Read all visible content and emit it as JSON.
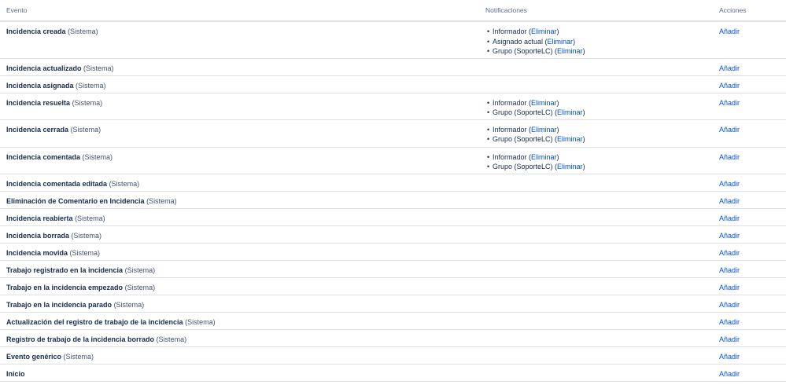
{
  "columns": {
    "event": "Evento",
    "notifications": "Notificaciones",
    "actions": "Acciones"
  },
  "colors": {
    "link": "#0052cc",
    "text": "#172b4d",
    "muted": "#5e6c84",
    "border": "#dfe1e6"
  },
  "icons": {
    "list_bullet": "•"
  },
  "remove_label": "Eliminar",
  "rows": [
    {
      "name": "Incidencia creada",
      "scope": "(Sistema)",
      "action": "Añadir",
      "notifications": [
        {
          "recipient": "Informador"
        },
        {
          "recipient": "Asignado actual"
        },
        {
          "recipient": "Grupo (SoporteLC)"
        }
      ]
    },
    {
      "name": "Incidencia actualizado",
      "scope": "(Sistema)",
      "action": "Añadir",
      "notifications": []
    },
    {
      "name": "Incidencia asignada",
      "scope": "(Sistema)",
      "action": "Añadir",
      "notifications": []
    },
    {
      "name": "Incidencia resuelta",
      "scope": "(Sistema)",
      "action": "Añadir",
      "notifications": [
        {
          "recipient": "Informador"
        },
        {
          "recipient": "Grupo (SoporteLC)"
        }
      ]
    },
    {
      "name": "Incidencia cerrada",
      "scope": "(Sistema)",
      "action": "Añadir",
      "notifications": [
        {
          "recipient": "Informador"
        },
        {
          "recipient": "Grupo (SoporteLC)"
        }
      ]
    },
    {
      "name": "Incidencia comentada",
      "scope": "(Sistema)",
      "action": "Añadir",
      "notifications": [
        {
          "recipient": "Informador"
        },
        {
          "recipient": "Grupo (SoporteLC)"
        }
      ]
    },
    {
      "name": "Incidencia comentada editada",
      "scope": "(Sistema)",
      "action": "Añadir",
      "notifications": []
    },
    {
      "name": "Eliminación de Comentario en Incidencia",
      "scope": "(Sistema)",
      "action": "Añadir",
      "notifications": []
    },
    {
      "name": "Incidencia reabierta",
      "scope": "(Sistema)",
      "action": "Añadir",
      "notifications": []
    },
    {
      "name": "Incidencia borrada",
      "scope": "(Sistema)",
      "action": "Añadir",
      "notifications": []
    },
    {
      "name": "Incidencia movida",
      "scope": "(Sistema)",
      "action": "Añadir",
      "notifications": []
    },
    {
      "name": "Trabajo registrado en la incidencia",
      "scope": "(Sistema)",
      "action": "Añadir",
      "notifications": []
    },
    {
      "name": "Trabajo en la incidencia empezado",
      "scope": "(Sistema)",
      "action": "Añadir",
      "notifications": []
    },
    {
      "name": "Trabajo en la incidencia parado",
      "scope": "(Sistema)",
      "action": "Añadir",
      "notifications": []
    },
    {
      "name": "Actualización del registro de trabajo de la incidencia",
      "scope": "(Sistema)",
      "action": "Añadir",
      "notifications": []
    },
    {
      "name": "Registro de trabajo de la incidencia borrado",
      "scope": "(Sistema)",
      "action": "Añadir",
      "notifications": []
    },
    {
      "name": "Evento genérico",
      "scope": "(Sistema)",
      "action": "Añadir",
      "notifications": []
    },
    {
      "name": "Inicio",
      "scope": "",
      "action": "Añadir",
      "notifications": []
    }
  ]
}
